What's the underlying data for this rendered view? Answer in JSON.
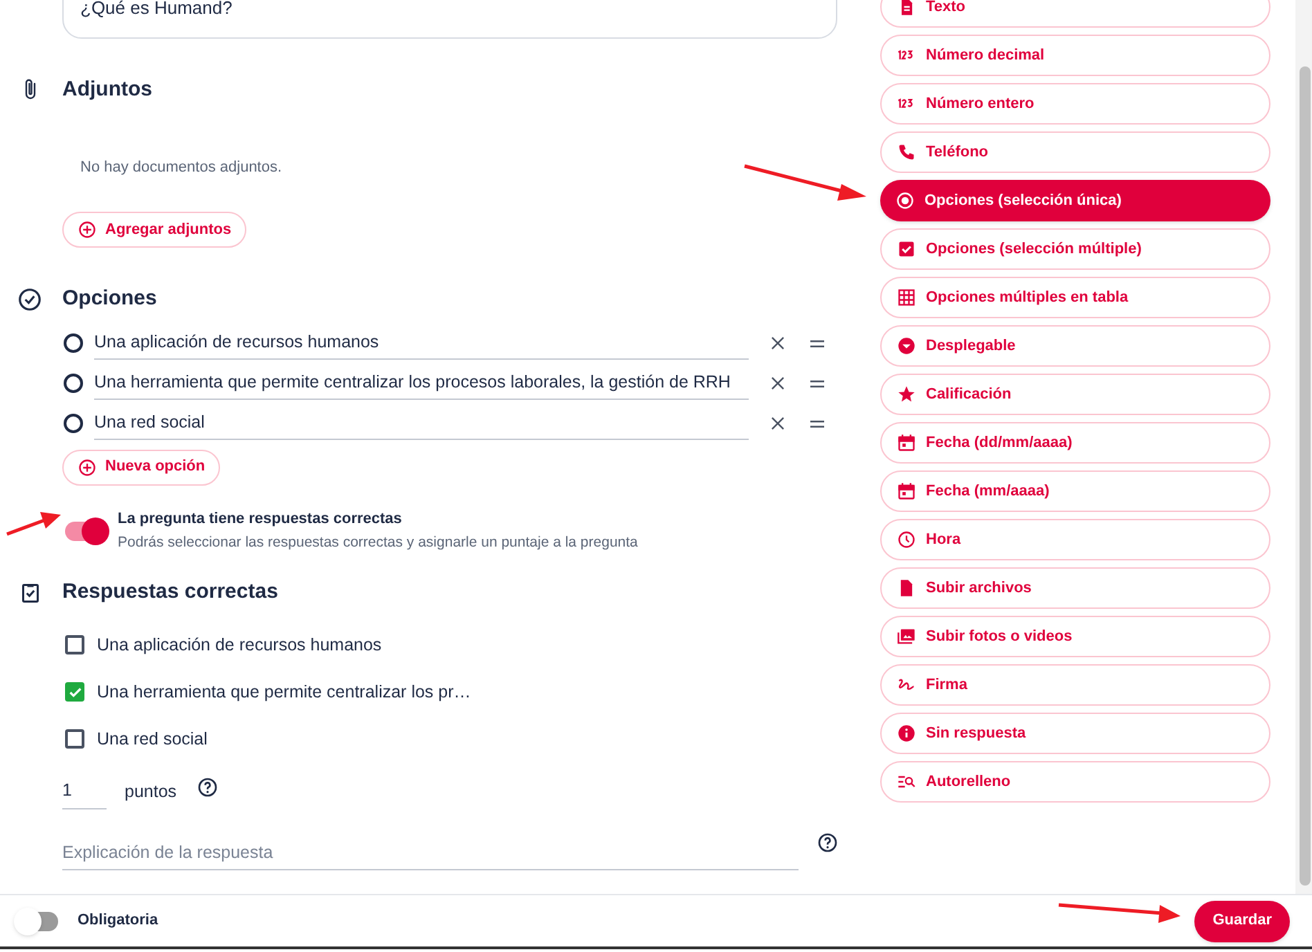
{
  "question": {
    "value": "¿Qué es Humand?"
  },
  "attachments": {
    "title": "Adjuntos",
    "empty_text": "No hay documentos adjuntos.",
    "add_button": "Agregar adjuntos"
  },
  "options": {
    "title": "Opciones",
    "items": [
      {
        "text": "Una aplicación de recursos humanos",
        "selected": false
      },
      {
        "text": "Una herramienta que permite centralizar los procesos laborales, la gestión de RRH",
        "selected": false
      },
      {
        "text": "Una red social",
        "selected": false
      }
    ],
    "add_button": "Nueva opción"
  },
  "correct_toggle": {
    "on": true,
    "label": "La pregunta tiene respuestas correctas",
    "description": "Podrás seleccionar las respuestas correctas y asignarle un puntaje a la pregunta"
  },
  "correct_answers": {
    "title": "Respuestas correctas",
    "items": [
      {
        "text": "Una aplicación de recursos humanos",
        "checked": false
      },
      {
        "text": "Una herramienta que permite centralizar los pr…",
        "checked": true
      },
      {
        "text": "Una red social",
        "checked": false
      }
    ],
    "points": {
      "value": "1",
      "label": "puntos"
    },
    "explanation": {
      "placeholder": "Explicación de la respuesta"
    }
  },
  "required_toggle": {
    "on": false,
    "label": "Obligatoria"
  },
  "save_button": "Guardar",
  "field_types": [
    {
      "label": "Texto",
      "selected": false
    },
    {
      "label": "Número decimal",
      "selected": false
    },
    {
      "label": "Número entero",
      "selected": false
    },
    {
      "label": "Teléfono",
      "selected": false
    },
    {
      "label": "Opciones (selección única)",
      "selected": true
    },
    {
      "label": "Opciones (selección múltiple)",
      "selected": false
    },
    {
      "label": "Opciones múltiples en tabla",
      "selected": false
    },
    {
      "label": "Desplegable",
      "selected": false
    },
    {
      "label": "Calificación",
      "selected": false
    },
    {
      "label": "Fecha (dd/mm/aaaa)",
      "selected": false
    },
    {
      "label": "Fecha (mm/aaaa)",
      "selected": false
    },
    {
      "label": "Hora",
      "selected": false
    },
    {
      "label": "Subir archivos",
      "selected": false
    },
    {
      "label": "Subir fotos o videos",
      "selected": false
    },
    {
      "label": "Firma",
      "selected": false
    },
    {
      "label": "Sin respuesta",
      "selected": false
    },
    {
      "label": "Autorelleno",
      "selected": false
    }
  ]
}
